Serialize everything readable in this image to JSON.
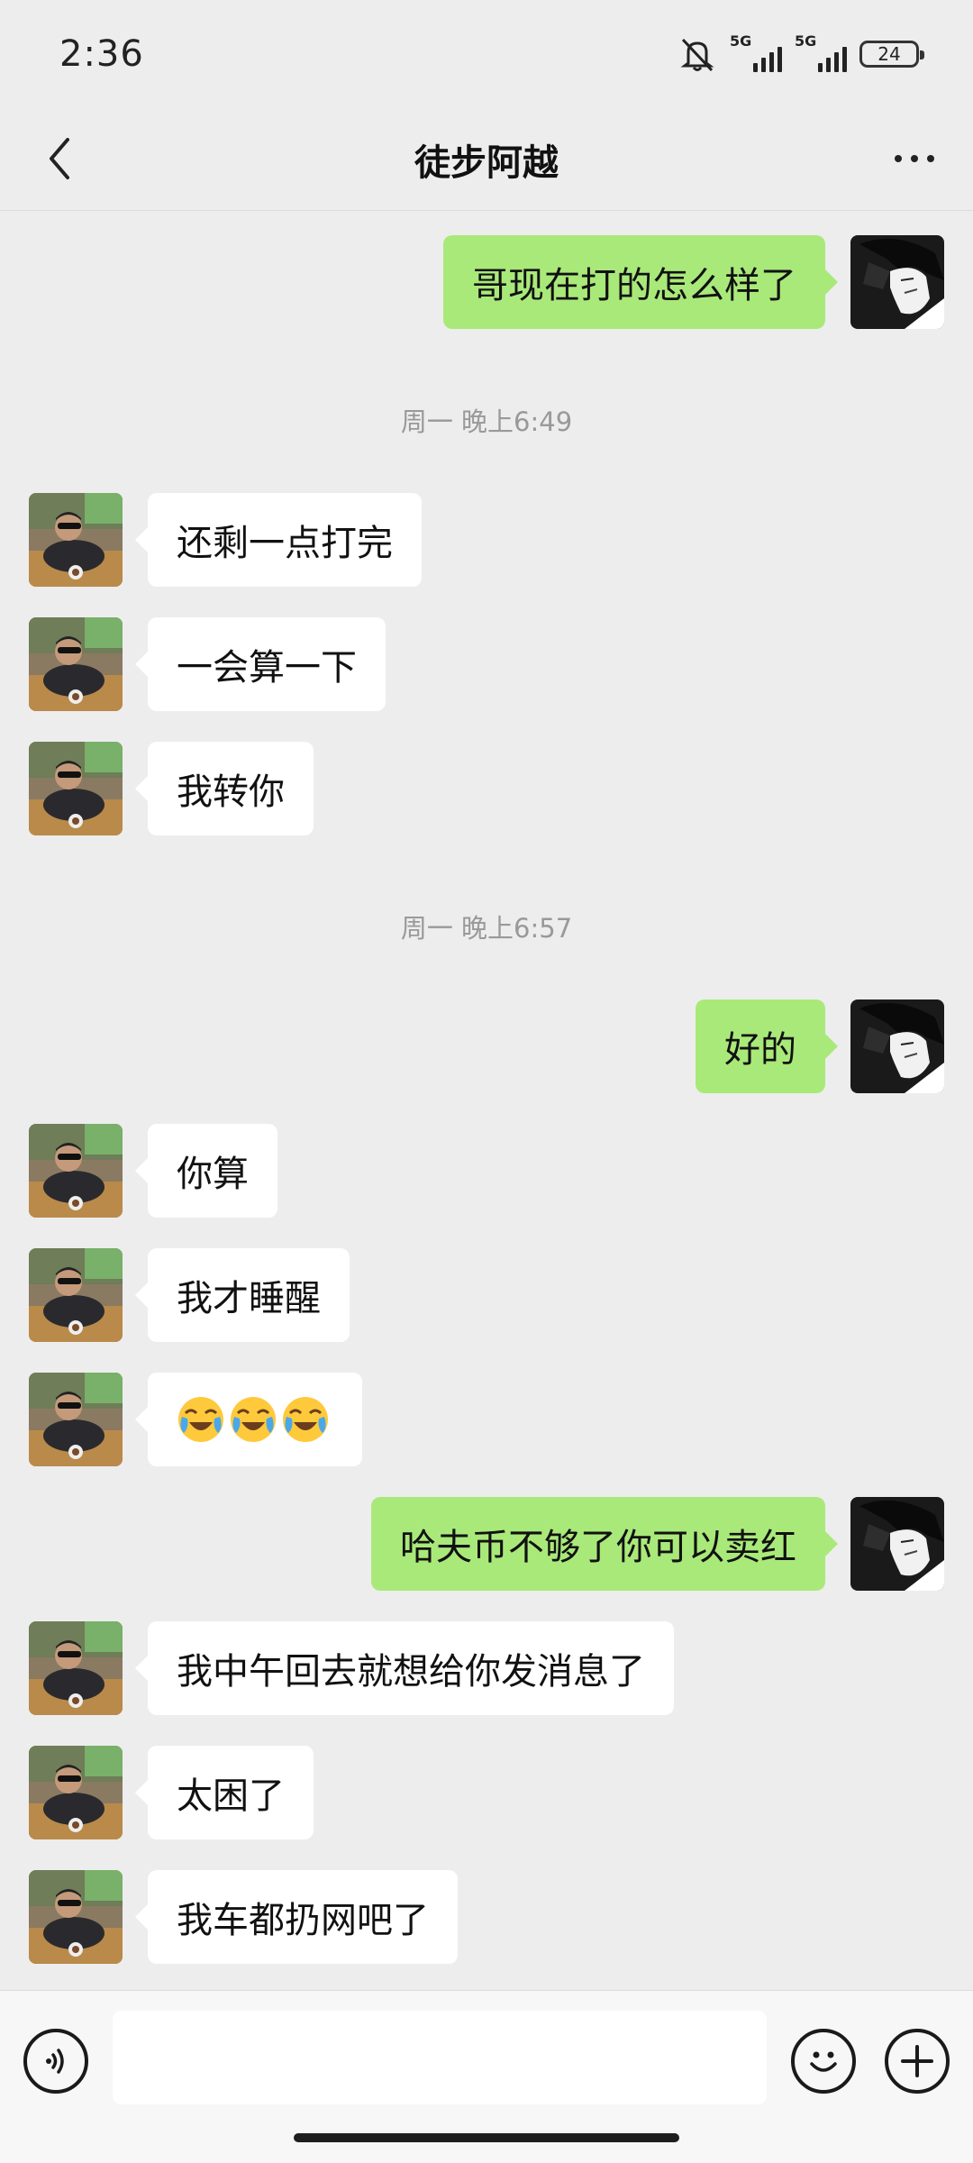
{
  "status_bar": {
    "time": "2:36",
    "network1": "5G",
    "network2": "5G",
    "battery": "24"
  },
  "header": {
    "title": "徒步阿越"
  },
  "messages": {
    "m0": "哥现在打的怎么样了",
    "t1": "周一 晚上6:49",
    "m1": "还剩一点打完",
    "m2": "一会算一下",
    "m3": "我转你",
    "t2": "周一 晚上6:57",
    "m4": "好的",
    "m5": "你算",
    "m6": "我才睡醒",
    "m8": "哈夫币不够了你可以卖红",
    "m9": "我中午回去就想给你发消息了",
    "m10": "太困了",
    "m11": "我车都扔网吧了"
  },
  "emoji_message": [
    "crying-laughing-emoji",
    "crying-laughing-emoji",
    "crying-laughing-emoji"
  ],
  "input": {
    "placeholder": ""
  }
}
